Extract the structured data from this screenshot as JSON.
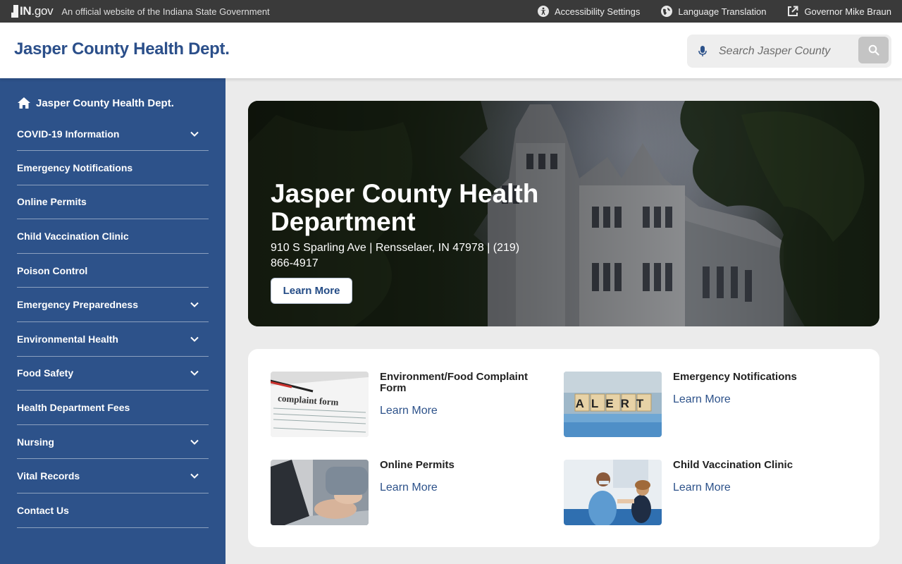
{
  "topbar": {
    "logo_text": "IN",
    "logo_suffix": ".gov",
    "official_text": "An official website of the Indiana State Government",
    "links": [
      {
        "label": "Accessibility Settings",
        "icon": "accessibility-icon"
      },
      {
        "label": "Language Translation",
        "icon": "globe-icon"
      },
      {
        "label": "Governor Mike Braun",
        "icon": "external-link-icon"
      }
    ]
  },
  "header": {
    "site_title": "Jasper County Health Dept.",
    "search": {
      "placeholder": "Search Jasper County",
      "value": ""
    }
  },
  "sidebar": {
    "home_label": "Jasper County Health Dept.",
    "items": [
      {
        "label": "COVID-19 Information",
        "expandable": true
      },
      {
        "label": "Emergency Notifications",
        "expandable": false
      },
      {
        "label": "Online Permits",
        "expandable": false
      },
      {
        "label": "Child Vaccination Clinic",
        "expandable": false
      },
      {
        "label": "Poison Control",
        "expandable": false
      },
      {
        "label": "Emergency Preparedness",
        "expandable": true
      },
      {
        "label": "Environmental Health",
        "expandable": true
      },
      {
        "label": "Food Safety",
        "expandable": true
      },
      {
        "label": "Health Department Fees",
        "expandable": false
      },
      {
        "label": "Nursing",
        "expandable": true
      },
      {
        "label": "Vital Records",
        "expandable": true
      },
      {
        "label": "Contact Us",
        "expandable": false
      }
    ]
  },
  "hero": {
    "title": "Jasper County Health Department",
    "address": "910 S Sparling Ave | Rensselaer, IN 47978 | (219) 866-4917",
    "button_label": "Learn More"
  },
  "cards": [
    {
      "title": "Environment/Food Complaint Form",
      "link": "Learn More",
      "image": "complaint-form-photo",
      "image_text": "complaint form"
    },
    {
      "title": "Emergency Notifications",
      "link": "Learn More",
      "image": "alert-blocks-photo",
      "image_text": "ALERT"
    },
    {
      "title": "Online Permits",
      "link": "Learn More",
      "image": "laptop-typing-photo"
    },
    {
      "title": "Child Vaccination Clinic",
      "link": "Learn More",
      "image": "vaccination-photo"
    }
  ],
  "colors": {
    "brand_blue": "#2d528a",
    "topbar": "#3a3a3a",
    "page_bg": "#ebebeb"
  }
}
